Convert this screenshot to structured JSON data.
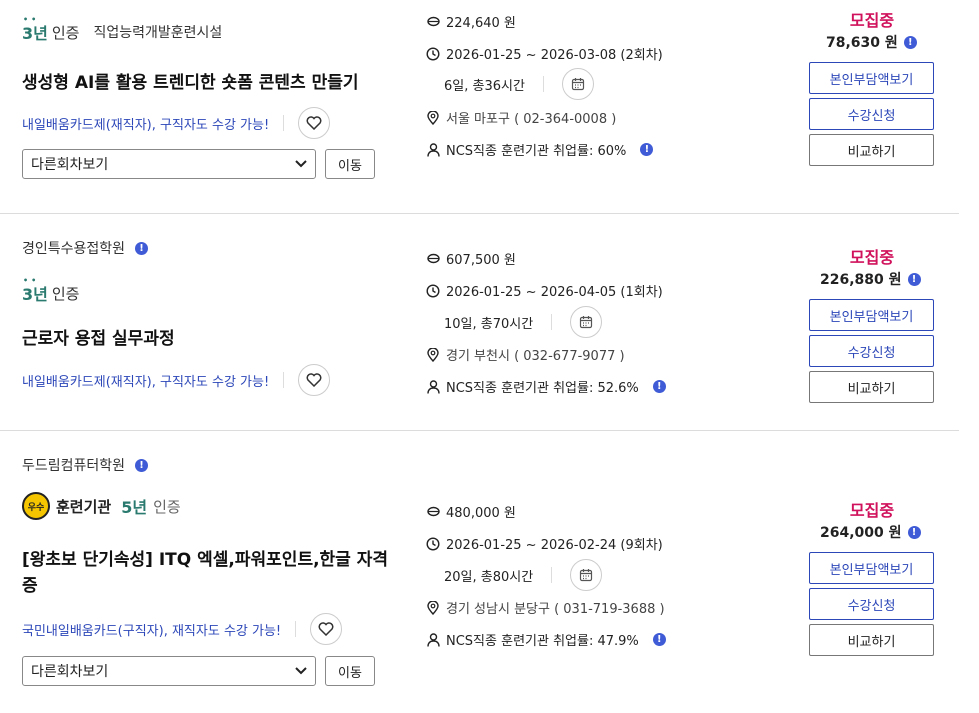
{
  "cards": [
    {
      "institution": "",
      "cert_years": "3년",
      "cert_word": "인증",
      "cert_institution_type": "직업능력개발훈련시설",
      "title": "생성형 AI를 활용 트렌디한 숏폼 콘텐츠 만들기",
      "card_types": "내일배움카드제(재직자), 구직자도 수강 가능!",
      "select_value": "다른회차보기",
      "move_label": "이동",
      "fee": "224,640 원",
      "period": "2026-01-25 ~ 2026-03-08 (2회차)",
      "duration": "6일, 총36시간",
      "location": "서울 마포구 ( 02-364-0008 )",
      "employment": "NCS직종 훈련기관 취업률: 60%",
      "status": "모집중",
      "self_pay": "78,630 원",
      "btn_self_pay": "본인부담액보기",
      "btn_apply": "수강신청",
      "btn_compare": "비교하기"
    },
    {
      "institution": "경인특수용접학원",
      "cert_years": "3년",
      "cert_word": "인증",
      "title": "근로자 용접 실무과정",
      "card_types": "내일배움카드제(재직자), 구직자도 수강 가능!",
      "fee": "607,500 원",
      "period": "2026-01-25 ~ 2026-04-05 (1회차)",
      "duration": "10일, 총70시간",
      "location": "경기 부천시 ( 032-677-9077 )",
      "employment": "NCS직종 훈련기관 취업률: 52.6%",
      "status": "모집중",
      "self_pay": "226,880 원",
      "btn_self_pay": "본인부담액보기",
      "btn_apply": "수강신청",
      "btn_compare": "비교하기"
    },
    {
      "institution": "두드림컴퓨터학원",
      "logo_text": "우수",
      "training_label": "훈련기관",
      "cert_years": "5년",
      "cert_word": "인증",
      "title": "[왕초보 단기속성] ITQ 엑셀,파워포인트,한글 자격증",
      "card_types": "국민내일배움카드(구직자), 재직자도 수강 가능!",
      "select_value": "다른회차보기",
      "move_label": "이동",
      "fee": "480,000 원",
      "period": "2026-01-25 ~ 2026-02-24 (9회차)",
      "duration": "20일, 총80시간",
      "location": "경기 성남시 분당구 ( 031-719-3688 )",
      "employment": "NCS직종 훈련기관 취업률: 47.9%",
      "status": "모집중",
      "self_pay": "264,000 원",
      "btn_self_pay": "본인부담액보기",
      "btn_apply": "수강신청",
      "btn_compare": "비교하기"
    }
  ],
  "colors": {
    "accent_blue": "#2c47b8",
    "status_red": "#d0115b",
    "cert_teal": "#2b7a6f",
    "info_dot": "#3f5bd6"
  }
}
